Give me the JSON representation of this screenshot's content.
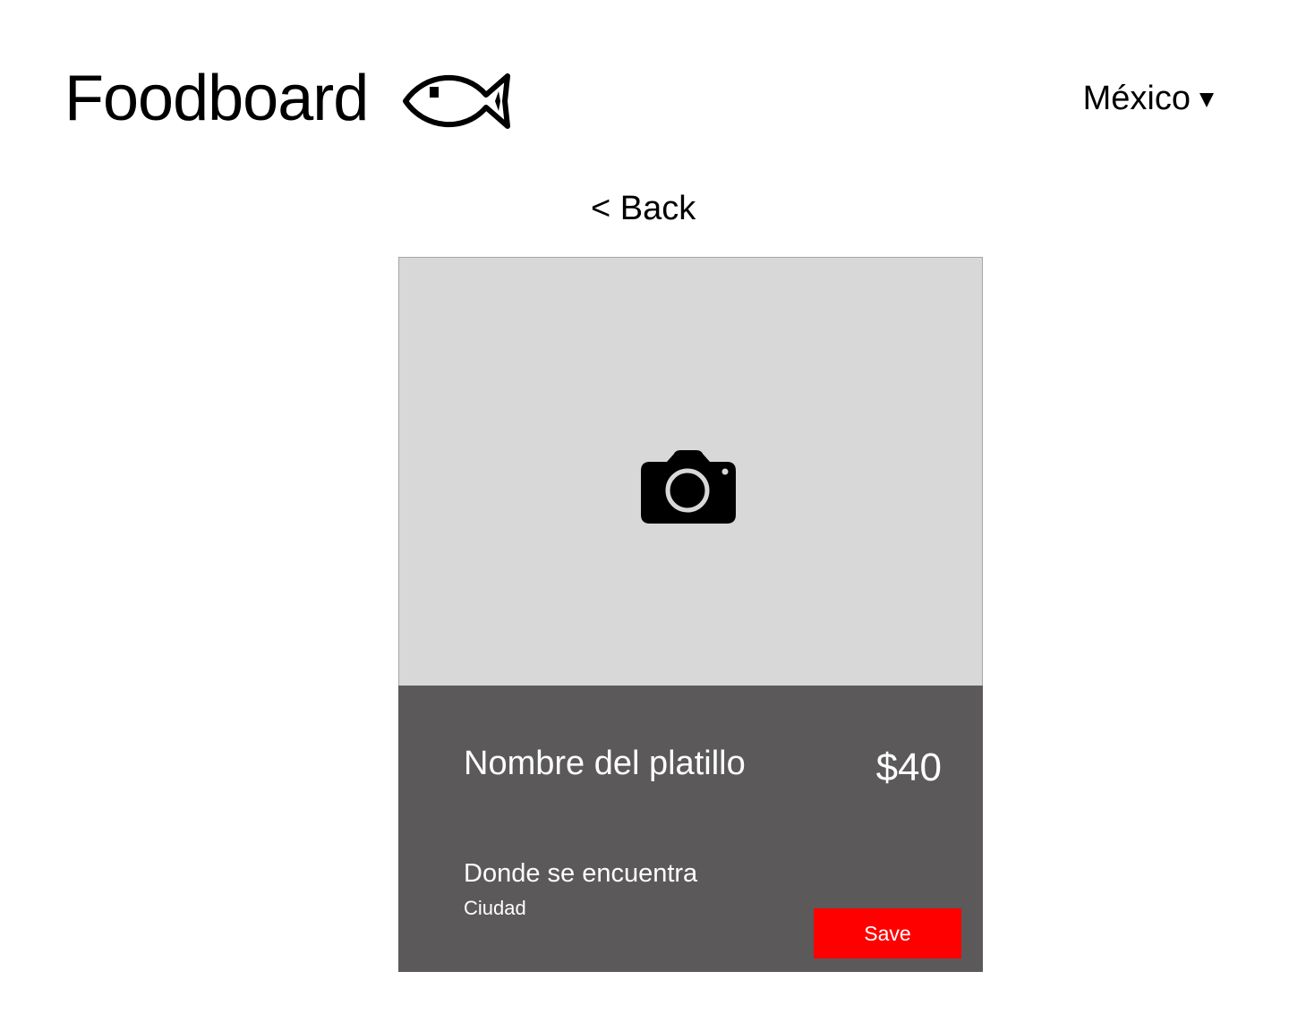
{
  "header": {
    "brand_title": "Foodboard",
    "logo_icon": "fish-icon",
    "country_selector": {
      "selected": "México",
      "caret_icon": "caret-down-icon"
    }
  },
  "navigation": {
    "back_label": "< Back"
  },
  "card": {
    "image_placeholder_icon": "camera-icon",
    "dish_name": "Nombre del platillo",
    "price": "$40",
    "location_label": "Donde se encuentra",
    "city": "Ciudad",
    "save_label": "Save"
  },
  "colors": {
    "image_placeholder_bg": "#d8d8d8",
    "info_panel_bg": "#5b595a",
    "save_button_bg": "#ff0000",
    "text_dark": "#000000",
    "text_light": "#ffffff"
  }
}
